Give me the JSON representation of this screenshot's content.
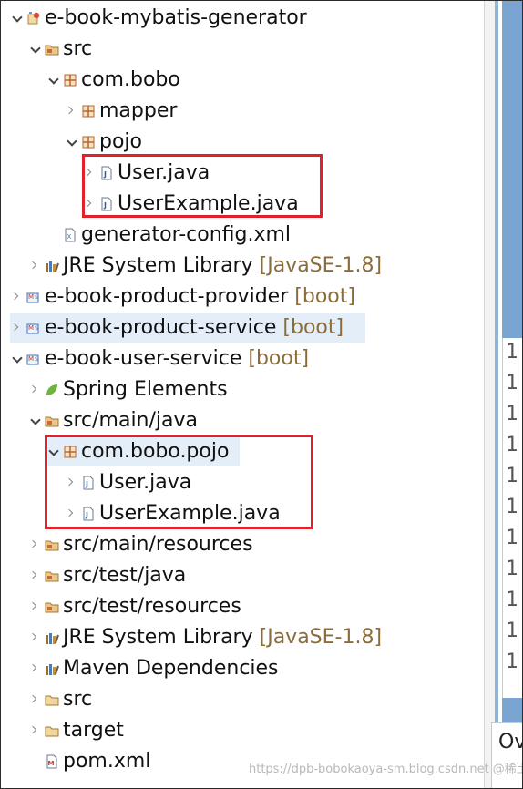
{
  "tree": [
    {
      "label": "e-book-mybatis-generator",
      "kind": "project-generator",
      "toggle": "open"
    },
    {
      "label": "src",
      "kind": "source-folder",
      "toggle": "open"
    },
    {
      "label": "com.bobo",
      "kind": "package",
      "toggle": "open"
    },
    {
      "label": "mapper",
      "kind": "package",
      "toggle": "closed"
    },
    {
      "label": "pojo",
      "kind": "package",
      "toggle": "open"
    },
    {
      "label": "User.java",
      "kind": "java-file",
      "toggle": "closed"
    },
    {
      "label": "UserExample.java",
      "kind": "java-file",
      "toggle": "closed"
    },
    {
      "label": "generator-config.xml",
      "kind": "xml-file",
      "toggle": "none"
    },
    {
      "label": "JRE System Library",
      "decoration": "[JavaSE-1.8]",
      "kind": "library",
      "toggle": "closed"
    },
    {
      "label": "e-book-product-provider",
      "decoration": "[boot]",
      "kind": "project-maven",
      "toggle": "closed"
    },
    {
      "label": "e-book-product-service",
      "decoration": "[boot]",
      "kind": "project-maven",
      "toggle": "closed",
      "selected": true
    },
    {
      "label": "e-book-user-service",
      "decoration": "[boot]",
      "kind": "project-maven",
      "toggle": "open"
    },
    {
      "label": "Spring Elements",
      "kind": "spring",
      "toggle": "closed"
    },
    {
      "label": "src/main/java",
      "kind": "source-folder",
      "toggle": "open"
    },
    {
      "label": "com.bobo.pojo",
      "kind": "package",
      "toggle": "open",
      "selected": true
    },
    {
      "label": "User.java",
      "kind": "java-file",
      "toggle": "closed"
    },
    {
      "label": "UserExample.java",
      "kind": "java-file",
      "toggle": "closed"
    },
    {
      "label": "src/main/resources",
      "kind": "source-folder",
      "toggle": "closed"
    },
    {
      "label": "src/test/java",
      "kind": "source-folder",
      "toggle": "closed"
    },
    {
      "label": "src/test/resources",
      "kind": "source-folder",
      "toggle": "closed"
    },
    {
      "label": "JRE System Library",
      "decoration": "[JavaSE-1.8]",
      "kind": "library",
      "toggle": "closed"
    },
    {
      "label": "Maven Dependencies",
      "kind": "library",
      "toggle": "closed"
    },
    {
      "label": "src",
      "kind": "folder",
      "toggle": "closed"
    },
    {
      "label": "target",
      "kind": "folder",
      "toggle": "closed"
    },
    {
      "label": "pom.xml",
      "kind": "pom-file",
      "toggle": "none"
    }
  ],
  "editor_line_numbers": [
    "1",
    "1",
    "1",
    "1",
    "1",
    "1",
    "1",
    "1",
    "1",
    "1",
    "1"
  ],
  "bottom_tab_label": "Ov",
  "watermark": "https://dpb-bobokaoya-sm.blog.csdn.net @稀土掘金技术社区",
  "colors": {
    "highlight_box": "#e0202a",
    "selection": "#e3eef9",
    "decoration": "#8a6d3b"
  }
}
